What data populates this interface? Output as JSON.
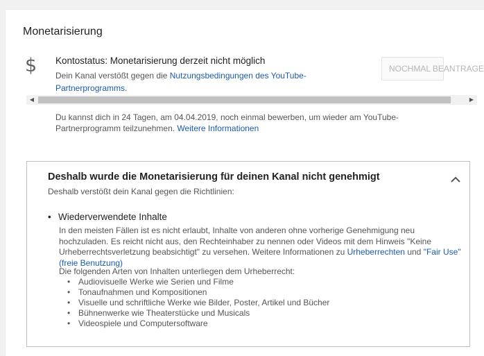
{
  "header": {
    "title": "Monetarisierung"
  },
  "status": {
    "icon": "dollar-icon",
    "title": "Kontostatus: Monetarisierung derzeit nicht möglich",
    "desc_prefix": "Dein Kanal verstößt gegen die ",
    "terms_link": "Nutzungsbedingungen des YouTube-Partnerprogramms",
    "desc_suffix": ".",
    "reapply_button": "NOCHMAL BEANTRAGEN"
  },
  "reapply_info": {
    "text": "Du kannst dich in 24 Tagen, am 04.04.2019, noch einmal bewerben, um wieder am YouTube-Partnerprogramm teilzunehmen. ",
    "link": "Weitere Informationen"
  },
  "panel": {
    "title": "Deshalb wurde die Monetarisierung für deinen Kanal nicht genehmigt",
    "subtitle": "Deshalb verstößt dein Kanal gegen die Richtlinien:",
    "collapse_icon": "chevron-up-icon",
    "reason": {
      "title": "Wiederverwendete Inhalte",
      "desc": "In den meisten Fällen ist es nicht erlaubt, Inhalte von anderen ohne vorherige Genehmigung neu hochzuladen. Es reicht nicht aus, den Rechteinhaber zu nennen oder Videos mit dem Hinweis \"Keine Urheberrechtsverletzung beabsichtigt\" zu versehen. Weitere Informationen zu ",
      "copyright_link": "Urheberrechten",
      "und": " und ",
      "fair_use_link": "\"Fair Use\" (freie Benutzung)",
      "types_intro": "Die folgenden Arten von Inhalten unterliegen dem Urheberrecht:",
      "types": [
        "Audiovisuelle Werke wie Serien und Filme",
        "Tonaufnahmen und Kompositionen",
        "Visuelle und schriftliche Werke wie Bilder, Poster, Artikel und Bücher",
        "Bühnenwerke wie Theaterstücke und Musicals",
        "Videospiele und Computersoftware"
      ]
    }
  },
  "colors": {
    "link": "#1a5bad",
    "text_secondary": "#555555",
    "background": "#f1f1f1"
  }
}
